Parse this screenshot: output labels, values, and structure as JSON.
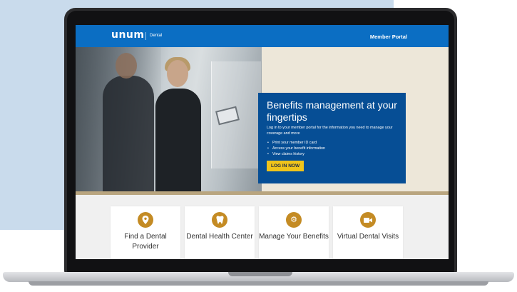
{
  "header": {
    "logo": "unum",
    "logo_sub": "Dental",
    "portal_link": "Member Portal"
  },
  "hero": {
    "title": "Benefits management at your fingertips",
    "description": "Log in to your member portal for the information you need to manage your coverage and more",
    "bullets": [
      "Print your member ID card",
      "Access your benefit information",
      "View claims history"
    ],
    "cta_label": "LOG IN NOW"
  },
  "cards": [
    {
      "title": "Find a Dental Provider",
      "icon": "location-pin-icon"
    },
    {
      "title": "Dental Health Center",
      "icon": "tooth-icon"
    },
    {
      "title": "Manage Your Benefits",
      "icon": "gear-icon"
    },
    {
      "title": "Virtual Dental Visits",
      "icon": "video-camera-icon"
    }
  ],
  "colors": {
    "header_blue": "#0b6ec3",
    "card_blue": "#064e95",
    "cta_yellow": "#f0c41b",
    "icon_gold": "#c48b24",
    "hero_beige": "#ede7d9"
  }
}
